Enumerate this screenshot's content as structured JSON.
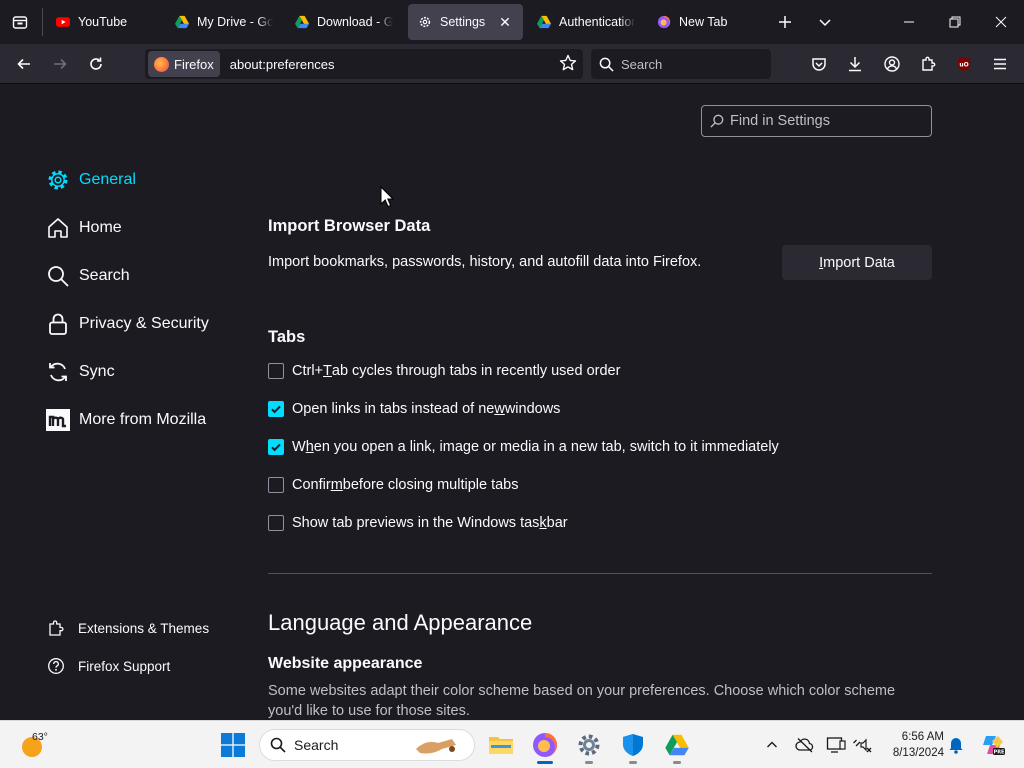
{
  "colors": {
    "accent": "#00ddff",
    "background": "#1c1b22",
    "toolbar": "#2b2a33",
    "active_tab": "#42414d"
  },
  "tabs": [
    {
      "label": "YouTube",
      "icon": "youtube-icon"
    },
    {
      "label": "My Drive - Go",
      "icon": "google-drive-icon"
    },
    {
      "label": "Download - Go",
      "icon": "google-drive-icon"
    },
    {
      "label": "Settings",
      "icon": "gear-icon",
      "active": true
    },
    {
      "label": "Authenticatior",
      "icon": "google-drive-icon"
    },
    {
      "label": "New Tab",
      "icon": "firefox-icon"
    }
  ],
  "navbar": {
    "identity_label": "Firefox",
    "url": "about:preferences",
    "search_placeholder": "Search"
  },
  "find_placeholder": "Find in Settings",
  "sidebar": {
    "categories": [
      {
        "label": "General",
        "icon": "gear-icon",
        "selected": true
      },
      {
        "label": "Home",
        "icon": "home-icon"
      },
      {
        "label": "Search",
        "icon": "search-icon"
      },
      {
        "label": "Privacy & Security",
        "icon": "lock-icon"
      },
      {
        "label": "Sync",
        "icon": "sync-icon"
      },
      {
        "label": "More from Mozilla",
        "icon": "mozilla-icon"
      }
    ],
    "links": [
      {
        "label": "Extensions & Themes",
        "icon": "puzzle-icon"
      },
      {
        "label": "Firefox Support",
        "icon": "help-icon"
      }
    ]
  },
  "import": {
    "title": "Import Browser Data",
    "description": "Import bookmarks, passwords, history, and autofill data into Firefox.",
    "button_pre": "",
    "button_key": "I",
    "button_post": "mport Data"
  },
  "tabs_section": {
    "title": "Tabs",
    "options": [
      {
        "pre": "Ctrl+",
        "key": "T",
        "post": "ab cycles through tabs in recently used order",
        "checked": false
      },
      {
        "pre": "Open links in tabs instead of ne",
        "key": "w",
        "post": " windows",
        "checked": true
      },
      {
        "pre": "W",
        "key": "h",
        "post": "en you open a link, image or media in a new tab, switch to it immediately",
        "checked": true
      },
      {
        "pre": "Confir",
        "key": "m",
        "post": " before closing multiple tabs",
        "checked": false
      },
      {
        "pre": "Show tab previews in the Windows tas",
        "key": "k",
        "post": "bar",
        "checked": false
      }
    ]
  },
  "language": {
    "title": "Language and Appearance",
    "website_title": "Website appearance",
    "website_desc": "Some websites adapt their color scheme based on your preferences. Choose which color scheme you'd like to use for those sites."
  },
  "taskbar": {
    "temperature": "63°",
    "search_placeholder": "Search",
    "time": "6:56 AM",
    "date": "8/13/2024"
  }
}
